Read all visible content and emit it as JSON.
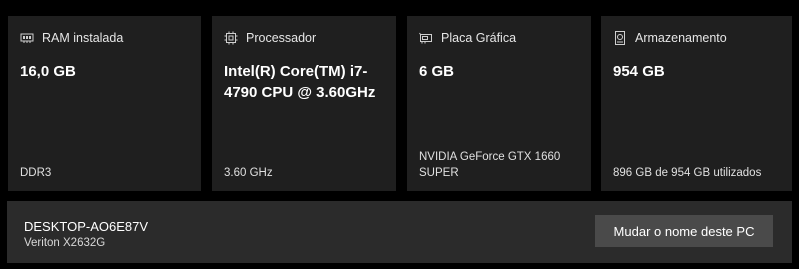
{
  "cards": [
    {
      "icon": "ram-icon",
      "title": "RAM instalada",
      "value": "16,0 GB",
      "footer": "DDR3"
    },
    {
      "icon": "processor-icon",
      "title": "Processador",
      "value": "Intel(R) Core(TM) i7-4790 CPU @ 3.60GHz",
      "footer": "3.60 GHz"
    },
    {
      "icon": "graphics-card-icon",
      "title": "Placa Gráfica",
      "value": "6 GB",
      "footer": "NVIDIA GeForce GTX 1660 SUPER"
    },
    {
      "icon": "storage-icon",
      "title": "Armazenamento",
      "value": "954 GB",
      "footer": "896 GB de 954 GB utilizados"
    }
  ],
  "device": {
    "name": "DESKTOP-AO6E87V",
    "model": "Veriton X2632G",
    "rename_label": "Mudar o nome deste PC"
  }
}
